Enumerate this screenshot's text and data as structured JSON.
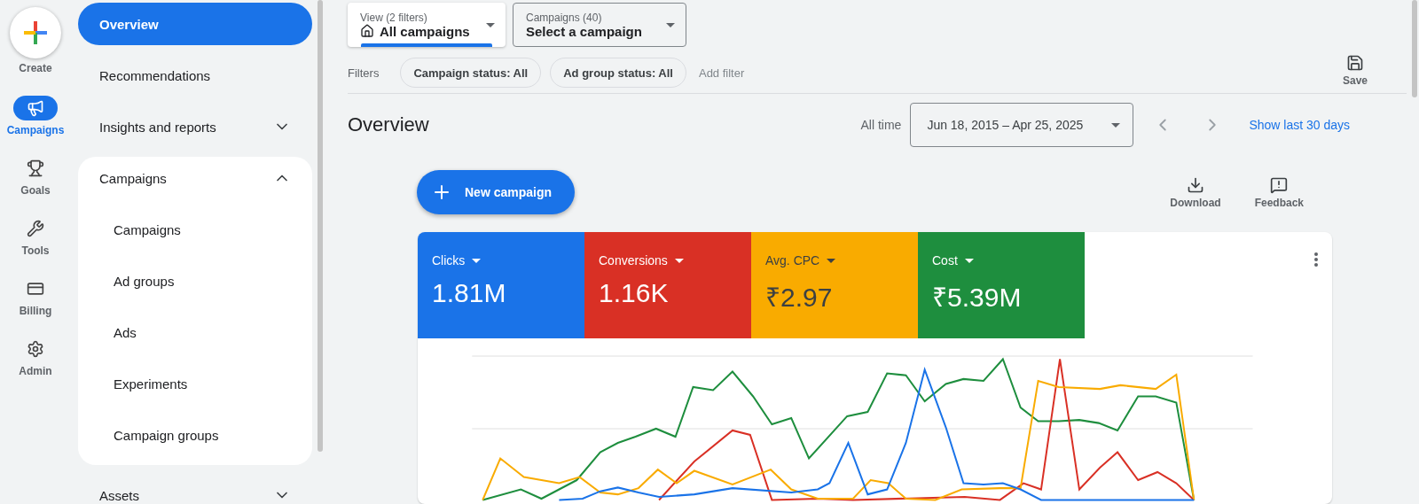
{
  "rail": {
    "create_label": "Create",
    "items": [
      {
        "kind": "campaigns",
        "label": "Campaigns",
        "selected": true
      },
      {
        "kind": "goals",
        "label": "Goals",
        "selected": false
      },
      {
        "kind": "tools",
        "label": "Tools",
        "selected": false
      },
      {
        "kind": "billing",
        "label": "Billing",
        "selected": false
      },
      {
        "kind": "admin",
        "label": "Admin",
        "selected": false
      }
    ]
  },
  "nav": {
    "items": [
      {
        "label": "Overview",
        "selected": true
      },
      {
        "label": "Recommendations",
        "selected": false
      },
      {
        "label": "Insights and reports",
        "selected": false,
        "expanded": false
      },
      {
        "label": "Campaigns",
        "selected": false,
        "expanded": true,
        "children": [
          {
            "label": "Campaigns",
            "selected": false
          },
          {
            "label": "Ad groups",
            "selected": false
          },
          {
            "label": "Ads",
            "selected": false
          },
          {
            "label": "Experiments",
            "selected": false
          },
          {
            "label": "Campaign groups",
            "selected": false
          }
        ]
      },
      {
        "label": "Assets",
        "selected": false,
        "expanded": false
      }
    ]
  },
  "view_picker": {
    "label": "View (2 filters)",
    "value": "All campaigns"
  },
  "campaign_picker": {
    "label": "Campaigns (40)",
    "value": "Select a campaign"
  },
  "filters": {
    "label": "Filters",
    "chips": [
      "Campaign status: All",
      "Ad group status: All"
    ],
    "add": "Add filter"
  },
  "save": "Save",
  "title": "Overview",
  "date": {
    "label": "All time",
    "range": "Jun 18, 2015 – Apr 25, 2025",
    "link": "Show last 30 days"
  },
  "new_campaign": "New campaign",
  "actions": [
    {
      "kind": "download",
      "label": "Download"
    },
    {
      "kind": "feedback",
      "label": "Feedback"
    }
  ],
  "metrics": [
    {
      "label": "Clicks",
      "value": "1.81M",
      "color": "#1a73e8"
    },
    {
      "label": "Conversions",
      "value": "1.16K",
      "color": "#d93025"
    },
    {
      "label": "Avg. CPC",
      "value": "₹2.97",
      "color": "#f9ab00"
    },
    {
      "label": "Cost",
      "value": "₹5.39M",
      "color": "#1e8e3e"
    }
  ]
}
